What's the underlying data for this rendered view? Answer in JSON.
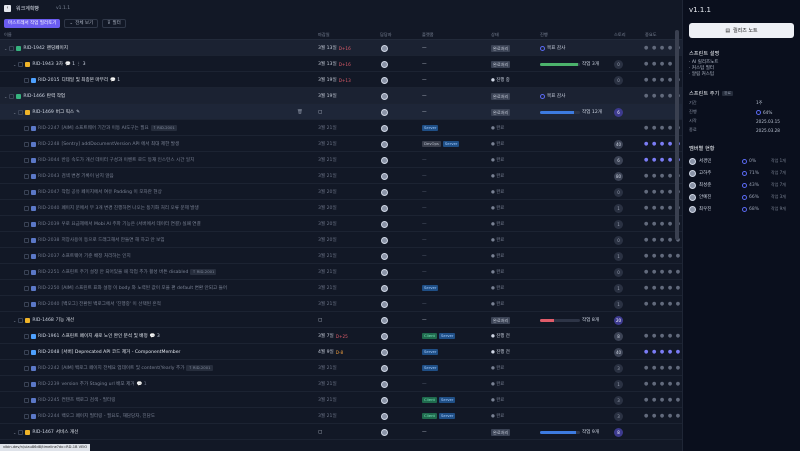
{
  "header": {
    "back_icon": "chevron-left-icon",
    "project": "워크계획빵",
    "version": "v1.1.1"
  },
  "toolbar": {
    "primary": "마스트레서 작업 필러토기",
    "expand": "전체 보기",
    "filter": "필터"
  },
  "columns": {
    "name": "이름",
    "due": "마감일",
    "assignee": "담당자",
    "platform": "플랫폼",
    "status": "상태",
    "progress": "진행",
    "sp": "스토리",
    "priority": "중요도"
  },
  "rows": [
    {
      "level": 0,
      "kind": "group",
      "type": "green",
      "id": "RID-1942",
      "title": "랜딩페이지",
      "due": "3월 13일",
      "dday": "D+16",
      "dday_color": "red",
      "status_badge": "완료처리",
      "progress_text": "목표 감사",
      "dots": "● ● ● ● ●"
    },
    {
      "level": 1,
      "kind": "parent",
      "type": "epic",
      "id": "RID-1943",
      "title": "3차",
      "meta": "💬 1 ⋮ 3",
      "due": "3월 13일",
      "dday": "D+16",
      "dday_color": "red",
      "status_badge": "완료처리",
      "progress": 0.95,
      "progress_color": "#4cb36c",
      "progress_text": "작업 3개",
      "badge": "0",
      "badge_style": "gray",
      "dots": "● ● ● ●"
    },
    {
      "level": 2,
      "kind": "item",
      "type": "story",
      "id": "RID-2015",
      "title": "디테일 및 최종본 마무리",
      "meta": "💬 1",
      "due": "3월 19일",
      "dday": "D+13",
      "dday_color": "red",
      "status_text": "● 진행 중",
      "badge": "0",
      "badge_style": "gray",
      "dots": "● ● ● ● ●"
    },
    {
      "level": 0,
      "kind": "group",
      "type": "green",
      "id": "RID-1466",
      "title": "탄력 작업",
      "due": "3월 19일",
      "status_badge": "완료처리",
      "progress_text": "목표 감사",
      "dots": "● ● ● ● ●"
    },
    {
      "level": 1,
      "kind": "parent",
      "type": "epic",
      "id": "RID-1469",
      "title": "버그 픽스",
      "hover": true,
      "due": "",
      "status_badge": "완료처리",
      "progress": 0.85,
      "progress_color": "#3d7be0",
      "progress_text": "작업 12개",
      "badge": "6",
      "badge_style": "",
      "dots": ""
    },
    {
      "level": 2,
      "kind": "item",
      "dim": true,
      "type": "task",
      "id": "RID-2247",
      "title": "[AIM] 소프트웨어 기간과 이동 AI도구는 필요",
      "tag": "RID-2001",
      "due": "3월 21일",
      "platform": [
        "Server"
      ],
      "status_text": "● 완료",
      "badge": "",
      "dots": "● ● ● ● ●"
    },
    {
      "level": 2,
      "kind": "item",
      "dim": true,
      "type": "task",
      "id": "RID-2248",
      "title": "[Sentry] addDocumentVersion API 에서 최대 제한 발생",
      "due": "3월 21일",
      "platform": [
        "DevOps",
        "Server"
      ],
      "status_text": "● 완료",
      "badge": "40",
      "badge_style": "light",
      "dots": "● ● ● ● ●",
      "dots_blue": true
    },
    {
      "level": 2,
      "kind": "item",
      "dim": true,
      "type": "task",
      "id": "RID-3044",
      "title": "반응 속도가 개선 데이터 구성과 이벤트 로드 등재 인스턴스 시간 일치",
      "due": "3월 21일",
      "status_text": "● 완료",
      "badge": "6",
      "badge_style": "light",
      "dots": "● ● ● ● ●",
      "dots_blue": true
    },
    {
      "level": 2,
      "kind": "item",
      "dim": true,
      "type": "task",
      "id": "RID-2043",
      "title": "검색 변경 기록이 남지 않음",
      "due": "3월 21일",
      "status_text": "● 완료",
      "badge": "80",
      "badge_style": "light",
      "dots": "● ● ● ● ●"
    },
    {
      "level": 2,
      "kind": "item",
      "dim": true,
      "type": "task",
      "id": "RID-2047",
      "title": "작업 공유 페이지에서 여유 Padding 이 모자란 현상",
      "due": "3월 20일",
      "status_text": "● 완료",
      "badge": "0",
      "badge_style": "gray",
      "dots": "● ● ● ● ●"
    },
    {
      "level": 2,
      "kind": "item",
      "dim": true,
      "type": "task",
      "id": "RID-2040",
      "title": "페이지 문에서 무 3개 변경 진행하면 나오는 동기화 처리 오류 문제 발생",
      "due": "3월 20일",
      "status_text": "● 완료",
      "badge": "1",
      "badge_style": "gray",
      "dots": "● ● ● ● ●"
    },
    {
      "level": 2,
      "kind": "item",
      "dim": true,
      "type": "task",
      "id": "RID-2039",
      "title": "우로 요금제에서 Mobi AI 주파 기능은 (서버에서 데이터 연결) 실패 연결",
      "due": "3월 20일",
      "status_text": "● 완료",
      "badge": "1",
      "badge_style": "gray",
      "dots": "● ● ● ● ●"
    },
    {
      "level": 2,
      "kind": "item",
      "dim": true,
      "type": "task",
      "id": "RID-2038",
      "title": "저장사용이 등으로 드래그해서 만들면 해 하고 안 보임",
      "due": "3월 20일",
      "status_text": "● 완료",
      "badge": "0",
      "badge_style": "gray",
      "dots": "● ● ● ● ●"
    },
    {
      "level": 2,
      "kind": "item",
      "dim": true,
      "type": "task",
      "id": "RID-2037",
      "title": "소프트웨어 기준 배정 처리하는 인지",
      "due": "3월 21일",
      "status_text": "● 완료",
      "badge": "1",
      "badge_style": "gray",
      "dots": "● ● ● ● ●"
    },
    {
      "level": 2,
      "kind": "item",
      "dim": true,
      "type": "task",
      "id": "RID-2251",
      "title": "스프린트 주기 설정 안 되어있을 때 작업 추가 활성 버튼 disabled",
      "tag": "RID-2001",
      "due": "3월 21일",
      "status_text": "● 완료",
      "badge": "0",
      "badge_style": "gray",
      "dots": "● ● ● ● ●"
    },
    {
      "level": 2,
      "kind": "item",
      "dim": true,
      "type": "task",
      "id": "RID-2250",
      "title": "[AIM] 스프린트 표와 설정 이 body 와 노력된 값이 모을 편 default 변환 안되고 들어",
      "due": "3월 21일",
      "platform": [
        "Server"
      ],
      "status_text": "● 완료",
      "badge": "1",
      "badge_style": "gray",
      "dots": "● ● ● ● ●"
    },
    {
      "level": 2,
      "kind": "item",
      "dim": true,
      "type": "task",
      "id": "RID-2040",
      "title": "[백오그] 전환된 백로그에서 '진행중' 이 선택된 흔적",
      "due": "3월 21일",
      "status_text": "● 완료",
      "badge": "1",
      "badge_style": "gray",
      "dots": "● ● ● ● ●"
    },
    {
      "level": 1,
      "kind": "parent",
      "type": "epic",
      "id": "RID-1468",
      "title": "기능 개선",
      "due": "",
      "status_badge": "완료처리",
      "progress": 0.35,
      "progress_color": "#e05c6a",
      "progress_text": "작업 8개",
      "badge": "20",
      "badge_style": "",
      "dots": ""
    },
    {
      "level": 2,
      "kind": "item",
      "type": "story",
      "id": "RID-1961",
      "title": "스프린트 페이지 새로 노인 완인 분석 및 배정",
      "meta": "💬 3",
      "due": "3월 7일",
      "dday": "D+25",
      "dday_color": "red",
      "platform": [
        "Client",
        "Server"
      ],
      "status_text": "● 진행 전",
      "badge": "8",
      "badge_style": "light",
      "dots": "● ● ● ● ●"
    },
    {
      "level": 2,
      "kind": "item",
      "type": "story",
      "id": "RID-2048",
      "title": "[서버] Deprecated API 코드 제거 - ComponentMember",
      "due": "4월 9일",
      "dday": "D-8",
      "dday_color": "orange",
      "platform": [
        "Server"
      ],
      "status_text": "● 진행 전",
      "badge": "40",
      "badge_style": "light",
      "dots": "● ● ● ● ●",
      "dots_blue": true
    },
    {
      "level": 2,
      "kind": "item",
      "dim": true,
      "type": "task",
      "id": "RID-2242",
      "title": "[AIM] 백로그 페이지 전체요 업데이트 및 content(Yearly 추가",
      "tag": "RID-2001",
      "due": "3월 21일",
      "platform": [
        "Server"
      ],
      "status_text": "● 완료",
      "badge": "3",
      "badge_style": "gray",
      "dots": "● ● ● ● ●"
    },
    {
      "level": 2,
      "kind": "item",
      "dim": true,
      "type": "task",
      "id": "RID-2239",
      "title": "version 추가 Staging url 배포 제거",
      "meta": "💬 1",
      "due": "3월 21일",
      "status_text": "● 완료",
      "badge": "1",
      "badge_style": "gray",
      "dots": "● ● ● ● ●"
    },
    {
      "level": 2,
      "kind": "item",
      "dim": true,
      "type": "task",
      "id": "RID-2245",
      "title": "컨텐츠 백로그 검색 - 필터링",
      "due": "3월 21일",
      "platform": [
        "Client",
        "Server"
      ],
      "status_text": "● 완료",
      "badge": "3",
      "badge_style": "gray",
      "dots": "● ● ● ● ●"
    },
    {
      "level": 2,
      "kind": "item",
      "dim": true,
      "type": "task",
      "id": "RID-2244",
      "title": "백오그 페이지 필터링 - 필요도, 재담당자, 진담도",
      "due": "3월 21일",
      "platform": [
        "Client",
        "Server"
      ],
      "status_text": "● 완료",
      "badge": "3",
      "badge_style": "gray",
      "dots": "● ● ● ● ●"
    },
    {
      "level": 1,
      "kind": "parent",
      "type": "epic",
      "id": "RID-1467",
      "title": "서비스 개선",
      "due": "",
      "status_badge": "완료처리",
      "progress": 0.9,
      "progress_color": "#3d7be0",
      "progress_text": "작업 9개",
      "badge": "8",
      "badge_style": "",
      "dots": ""
    }
  ],
  "statusbar": {
    "url": "vibin.dev/n/uiau86d8/timeline?dx=RD-1B  VEIO"
  },
  "sidebar": {
    "version": "v1.1.1",
    "notes_button": "릴리즈 노트",
    "notes_icon": "document-icon",
    "desc_title": "스프린트 설명",
    "desc_items": [
      "· AI 릴리즈노트",
      "· 커스텀 필터",
      "· 알림 커스텀"
    ],
    "cycle_title": "스프린트 주기",
    "cycle_tag": "완료",
    "cycle_rows": [
      {
        "k": "기간",
        "v": "1주"
      },
      {
        "k": "진행",
        "v": "64%",
        "ring": true
      },
      {
        "k": "시작",
        "v": "2025.03.15"
      },
      {
        "k": "종료",
        "v": "2025.03.28"
      }
    ],
    "members_title": "멤버별 현황",
    "members": [
      {
        "name": "서경민",
        "pct": "0%",
        "label": "작업 1개"
      },
      {
        "name": "고하주",
        "pct": "71%",
        "label": "작업 7개"
      },
      {
        "name": "최성준",
        "pct": "43%",
        "label": "작업 7개"
      },
      {
        "name": "안예진",
        "pct": "66%",
        "label": "작업 3개"
      },
      {
        "name": "최우진",
        "pct": "68%",
        "label": "작업 9개"
      }
    ]
  }
}
